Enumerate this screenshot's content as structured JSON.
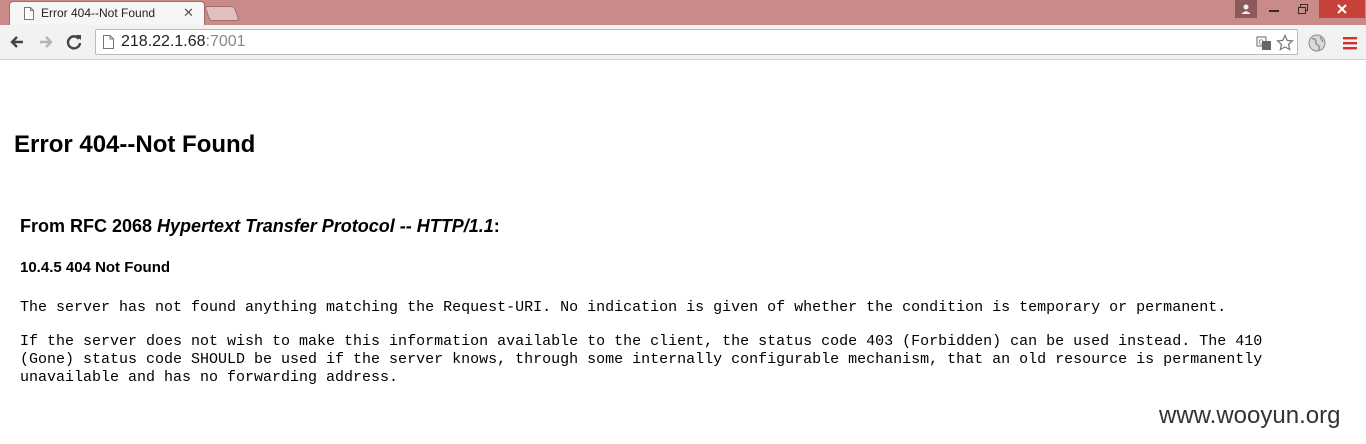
{
  "tab": {
    "title": "Error 404--Not Found",
    "close_symbol": "✕"
  },
  "omnibox": {
    "host": "218.22.1.68",
    "port": ":7001"
  },
  "icons": {
    "back": "back-arrow-icon",
    "forward": "forward-arrow-icon",
    "reload": "reload-icon",
    "page": "page-icon",
    "translate": "translate-icon",
    "bookmark": "star-icon",
    "extension": "globe-icon",
    "menu": "hamburger-menu-icon"
  },
  "colors": {
    "menu_icon": "#d0312d",
    "window_close": "#c7403a",
    "title_bar": "#c98a8a"
  },
  "page": {
    "heading": "Error 404--Not Found",
    "rfc_prefix": "From RFC 2068 ",
    "rfc_title": "Hypertext Transfer Protocol -- HTTP/1.1",
    "rfc_suffix": ":",
    "section": "10.4.5 404 Not Found",
    "paragraph1": "The server has not found anything matching the Request-URI. No indication is given of whether the condition is temporary or permanent.",
    "paragraph2": "If the server does not wish to make this information available to the client, the status code 403 (Forbidden) can be used instead. The 410\n(Gone) status code SHOULD be used if the server knows, through some internally configurable mechanism, that an old resource is permanently\nunavailable and has no forwarding address."
  },
  "watermark": "www.wooyun.org"
}
